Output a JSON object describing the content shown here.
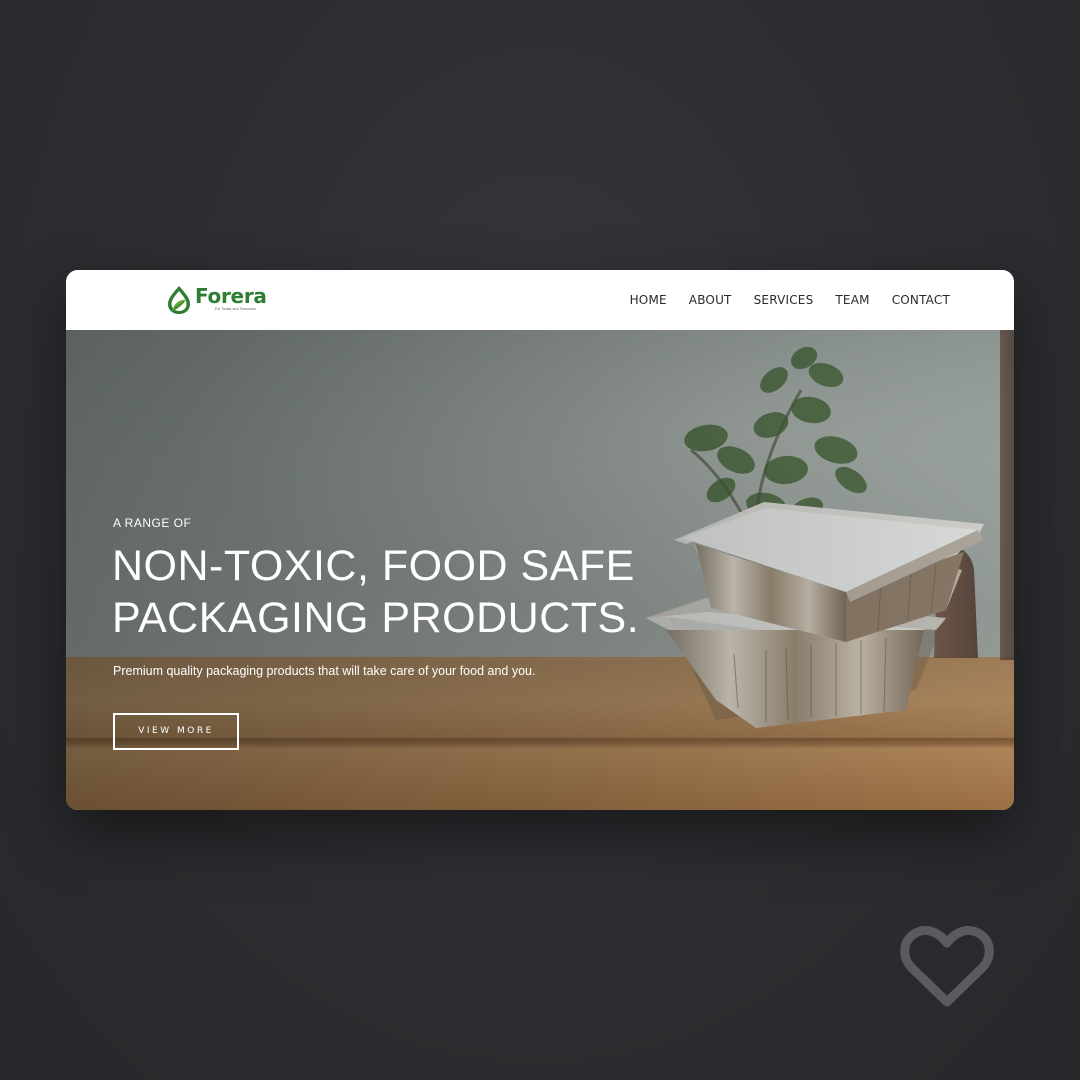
{
  "brand": {
    "name": "Forera",
    "tagline": "For Today and Tomorrow",
    "color": "#2e7d32",
    "icon": "leaf-drop-logo-icon"
  },
  "nav": {
    "items": [
      {
        "label": "HOME"
      },
      {
        "label": "ABOUT"
      },
      {
        "label": "SERVICES"
      },
      {
        "label": "TEAM"
      },
      {
        "label": "CONTACT"
      }
    ]
  },
  "hero": {
    "kicker": "A RANGE OF",
    "headline_line1": "NON-TOXIC, FOOD SAFE",
    "headline_line2": "PACKAGING PRODUCTS.",
    "subtitle": "Premium quality packaging products that will take care of your food and you.",
    "cta_label": "VIEW MORE",
    "image_subject": "aluminium-foil-food-containers-on-wooden-table-with-plant"
  },
  "overlay": {
    "icon": "heart-icon"
  }
}
